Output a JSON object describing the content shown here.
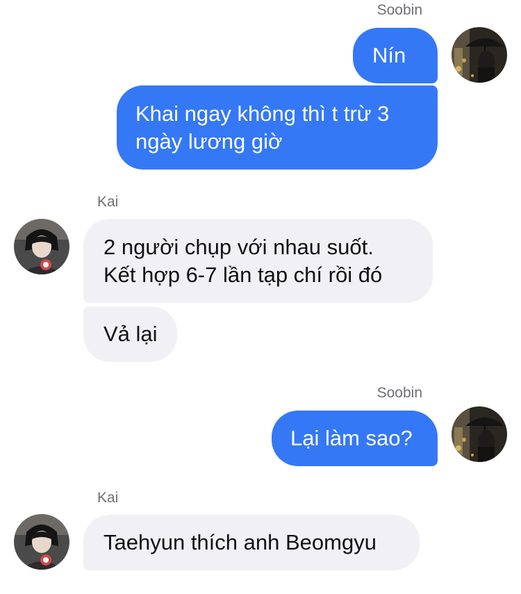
{
  "messages": [
    {
      "sender": "Soobin",
      "bubbles": [
        {
          "lines": [
            "Nín"
          ]
        },
        {
          "lines": [
            "Khai ngay không thì t trừ 3",
            "ngày lương giờ"
          ]
        }
      ],
      "avatar_icon": "soobin-umbrella-night-avatar"
    },
    {
      "sender": "Kai",
      "bubbles": [
        {
          "lines": [
            "2 người chụp với nhau suốt.",
            "Kết hợp 6-7 lần tạp chí rồi đó"
          ]
        },
        {
          "lines": [
            "Vả lại"
          ]
        }
      ],
      "avatar_icon": "kai-portrait-avatar"
    },
    {
      "sender": "Soobin",
      "bubbles": [
        {
          "lines": [
            "Lại làm sao?"
          ]
        }
      ],
      "avatar_icon": "soobin-umbrella-night-avatar"
    },
    {
      "sender": "Kai",
      "bubbles": [
        {
          "lines": [
            "Taehyun thích anh Beomgyu"
          ]
        }
      ],
      "avatar_icon": "kai-portrait-avatar"
    }
  ],
  "colors": {
    "outgoing_bubble": "#3478f6",
    "incoming_bubble": "#f0f0f5",
    "sender_label": "#6e6e73"
  }
}
